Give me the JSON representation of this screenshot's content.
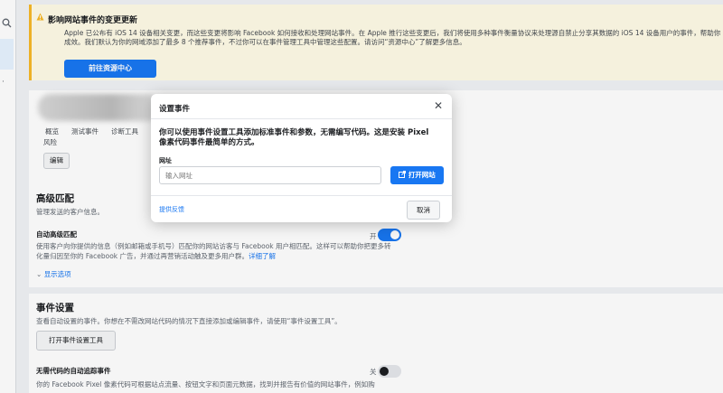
{
  "left_rail": {
    "search_icon": "search-icon"
  },
  "banner": {
    "title": "影响网站事件的变更更新",
    "body_line1": "Apple 已公布有 iOS 14 设备相关变更，而这些变更将影响 Facebook 如何接收和处理网站事件。在 Apple 推行这些变更后，我们将使用多种事件衡量协议来处理源自禁止分享其数据的 iOS 14 设备用户的事件，帮助你",
    "body_line2": "成效。我们默认为你的网域添加了最多 8 个推荐事件，不过你可以在事件管理工具中管理这些配置。请访问“资源中心”了解更多信息。",
    "button": "前往资源中心",
    "accent_color": "#f7b928"
  },
  "overview_card": {
    "tabs": [
      "概览",
      "测试事件",
      "诊断工具"
    ],
    "partial_text": "风险",
    "edit_button": "编辑"
  },
  "advanced_matching": {
    "title": "高级匹配",
    "subtitle": "管理发送的客户信息。",
    "auto_label": "自动高级匹配",
    "toggle_text": "开",
    "toggle_on": true,
    "desc_line1": "使用客户向你提供的信息（例如邮箱或手机号）匹配你的网站访客与 Facebook 用户相匹配。这样可以帮助你把更多转",
    "desc_line2": "化量归因至你的 Facebook 广告，并通过再营销活动触及更多用户群。",
    "learn_more": "详细了解",
    "show_options": "显示选项"
  },
  "event_setup": {
    "title": "事件设置",
    "subtitle": "查看自动设置的事件。你想在不需改网站代码的情况下直接添加或编辑事件，请使用“事件设置工具”。",
    "button": "打开事件设置工具",
    "code_free_label": "无需代码的自动追踪事件",
    "code_free_toggle_text": "关",
    "code_free_on": false,
    "code_free_desc": "你的 Facebook Pixel 像素代码可根据站点流量、按钮文字和页面元数据，找到并报告有价值的网站事件，例如购"
  },
  "dialog": {
    "title": "设置事件",
    "intro_line1": "你可以使用事件设置工具添加标准事件和参数，无需编写代码。这是安装 Pixel",
    "intro_line2": "像素代码事件最简单的方式。",
    "url_label": "网址",
    "url_placeholder": "输入网址",
    "open_button": "打开网站",
    "feedback_link": "提供反馈",
    "cancel_button": "取消",
    "brand_color": "#1877f2"
  }
}
